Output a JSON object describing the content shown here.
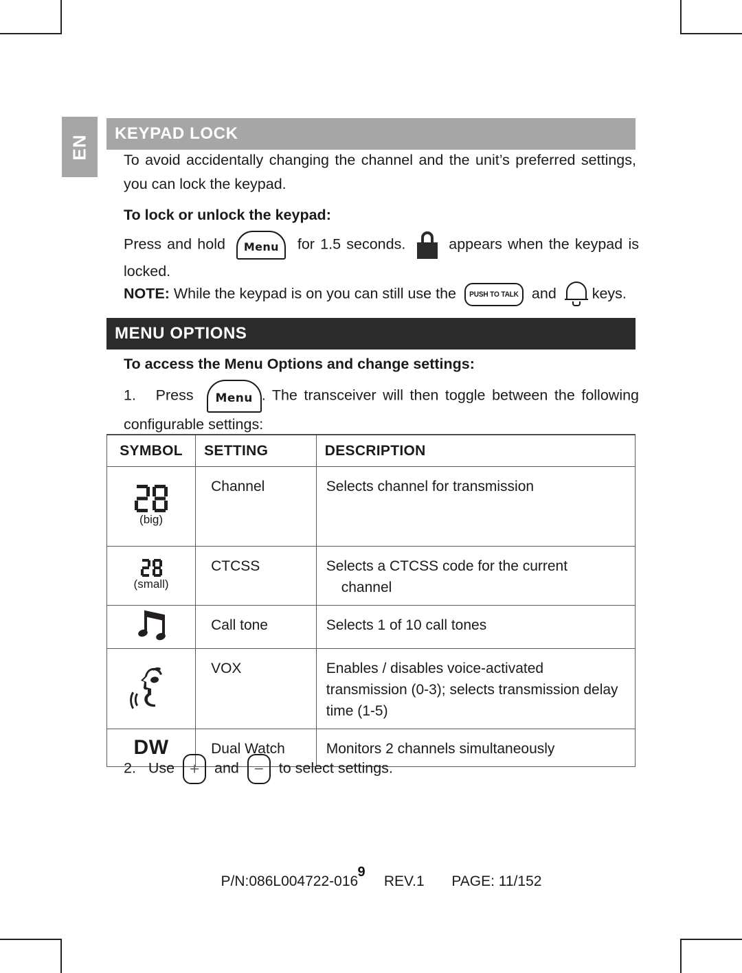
{
  "language_tab": "EN",
  "sections": [
    {
      "id": "keypad-lock",
      "title": "KEYPAD LOCK",
      "style": "gray"
    },
    {
      "id": "menu-options",
      "title": "MENU OPTIONS",
      "style": "dark"
    }
  ],
  "keypad_lock": {
    "intro": "To avoid accidentally changing the channel and the unit’s preferred settings, you can lock the keypad.",
    "subheading": "To lock or unlock the keypad:",
    "press_prefix": "Press and hold",
    "press_middle": "for 1.5 seconds.",
    "press_suffix": "appears when the keypad is locked.",
    "note_label": "NOTE:",
    "note_text": "While the keypad is on you can still use the",
    "note_and": "and",
    "note_end": "keys.",
    "menu_key_label": "Menu",
    "ptt_key_label": "PUSH TO TALK"
  },
  "menu_options": {
    "subheading": "To access the Menu Options and change settings:",
    "step1_number": "1.",
    "step1_prefix": "Press",
    "step1_suffix": ". The transceiver will then toggle between the following configurable settings:",
    "menu_key_label": "Menu",
    "step2_number": "2.",
    "step2_prefix": "Use",
    "step2_and": "and",
    "step2_suffix": "to select settings.",
    "plus_key_label": "+",
    "minus_key_label": "−"
  },
  "table": {
    "headers": [
      "SYMBOL",
      "SETTING",
      "DESCRIPTION"
    ],
    "rows": [
      {
        "symbol_type": "seven-segment-big",
        "symbol_text": "88",
        "symbol_note": "(big)",
        "setting": "Channel",
        "description": "Selects channel for transmission",
        "description_line2": ""
      },
      {
        "symbol_type": "seven-segment-small",
        "symbol_text": "88",
        "symbol_note": "(small)",
        "setting": "CTCSS",
        "description": "Selects a CTCSS code for the current",
        "description_line2": "channel"
      },
      {
        "symbol_type": "music-note",
        "symbol_text": "",
        "symbol_note": "",
        "setting": "Call tone",
        "description": "Selects 1 of 10 call tones",
        "description_line2": ""
      },
      {
        "symbol_type": "vox-face",
        "symbol_text": "",
        "symbol_note": "",
        "setting": "VOX",
        "description": "Enables / disables voice-activated transmission (0-3); selects transmission delay time (1-5)",
        "description_line2": ""
      },
      {
        "symbol_type": "text",
        "symbol_text": "DW",
        "symbol_note": "",
        "setting": "Dual Watch",
        "description": "Monitors 2 channels simultaneously",
        "description_line2": ""
      }
    ]
  },
  "footer": {
    "part_number": "P/N:086L004722-016",
    "revision": "REV.1",
    "page_label": "PAGE: 11/152",
    "page_number": "9"
  },
  "colors": {
    "header_gray": "#a6a6a6",
    "header_dark": "#2b2b2b",
    "text": "#1a1a1a",
    "rule": "#5a5a5a"
  }
}
